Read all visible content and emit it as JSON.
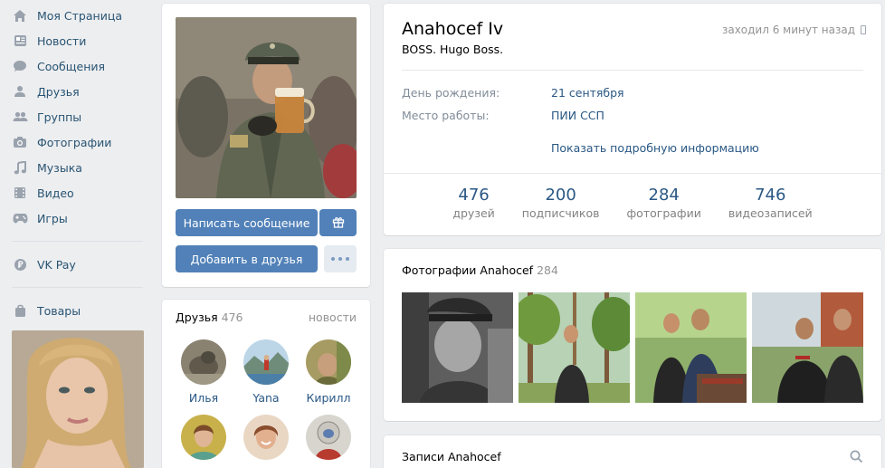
{
  "nav": {
    "items": [
      {
        "label": "Моя Страница",
        "icon": "home-icon"
      },
      {
        "label": "Новости",
        "icon": "news-icon"
      },
      {
        "label": "Сообщения",
        "icon": "messages-icon"
      },
      {
        "label": "Друзья",
        "icon": "user-icon"
      },
      {
        "label": "Группы",
        "icon": "groups-icon"
      },
      {
        "label": "Фотографии",
        "icon": "camera-icon"
      },
      {
        "label": "Музыка",
        "icon": "music-icon"
      },
      {
        "label": "Видео",
        "icon": "video-icon"
      },
      {
        "label": "Игры",
        "icon": "gamepad-icon"
      }
    ],
    "vkpay": {
      "label": "VK Pay",
      "icon": "vkpay-icon"
    },
    "goods": {
      "label": "Товары",
      "icon": "shopping-bag-icon"
    }
  },
  "profile": {
    "name": "Anahocef Iv",
    "status": "BOSS. Hugo Boss.",
    "last_seen": "заходил 6 минут назад",
    "birthday_label": "День рождения:",
    "birthday_value": "21 сентября",
    "work_label": "Место работы:",
    "work_value": "ПИИ ССП",
    "more_link": "Показать подробную информацию",
    "counters": [
      {
        "value": "476",
        "label": "друзей"
      },
      {
        "value": "200",
        "label": "подписчиков"
      },
      {
        "value": "284",
        "label": "фотографии"
      },
      {
        "value": "746",
        "label": "видеозаписей"
      }
    ]
  },
  "actions": {
    "message": "Написать сообщение",
    "add_friend": "Добавить в друзья"
  },
  "friends": {
    "title": "Друзья",
    "count": "476",
    "link": "новости",
    "list": [
      {
        "name": "Илья"
      },
      {
        "name": "Yana"
      },
      {
        "name": "Кирилл"
      },
      {
        "name": ""
      },
      {
        "name": ""
      },
      {
        "name": ""
      }
    ]
  },
  "photos": {
    "title": "Фотографии Anahocef",
    "count": "284"
  },
  "wall": {
    "title": "Записи Anahocef"
  },
  "colors": {
    "background": "#edeef0",
    "accent": "#5181b8",
    "link": "#2a5885",
    "nav_text": "#285473"
  }
}
